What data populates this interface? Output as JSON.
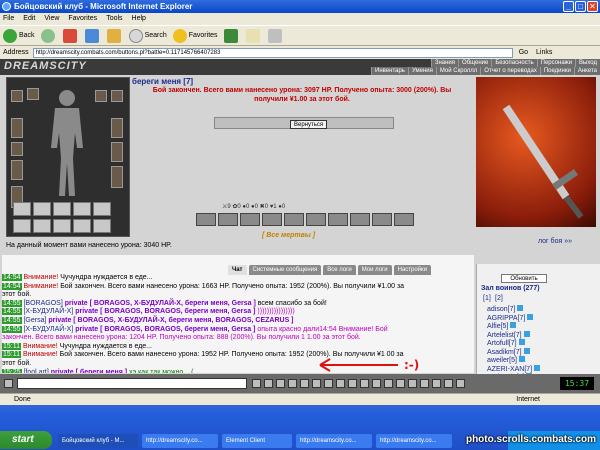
{
  "window": {
    "title": "Бойцовский клуб - Microsoft Internet Explorer",
    "menu": [
      "File",
      "Edit",
      "View",
      "Favorites",
      "Tools",
      "Help"
    ],
    "toolbar": {
      "back": "Back",
      "search": "Search",
      "favorites": "Favorites"
    },
    "address_label": "Address",
    "address_value": "http://dreamscity.combats.com/buttons.pl?battle=0.117145766407283",
    "go": "Go",
    "links": "Links"
  },
  "game": {
    "logo": "DREAMSCITY",
    "nav_top": [
      "Знания",
      "Общение",
      "Безопасность",
      "Персонажи",
      "Выход"
    ],
    "nav_bottom": [
      "Инвентарь",
      "Умения",
      "Мой Скроллл",
      "Отчет о переводах",
      "Поединки",
      "Анкета"
    ],
    "fighter_name": "береги меня [7]",
    "battle_result_line1": "Бой закончен. Всего вами нанесено урона: 3097 HP. Получено опыта: 3000 (200%). Вы",
    "battle_result_line2": "получили ¥1.00 за этот бой.",
    "return_button": "Вернуться",
    "counters": "⚔9   ✿0   ●0   ●0   ✖0   ♥1   ●0",
    "all_dead": "[ Все мертвы ]",
    "damage_text": "На данный момент вами нанесено урона: 3040 HP.",
    "battle_log_link": "лог боя »»"
  },
  "chat": {
    "tabs": [
      "Чат",
      "Системные сообщения",
      "Все логи",
      "Мои логи",
      "Настройки"
    ],
    "active_tab": "Чат",
    "lines": [
      {
        "t": "14:54",
        "parts": [
          {
            "c": "warn",
            "v": "Внимание!"
          },
          {
            "c": "",
            "v": " Чучундра нуждается в еде..."
          }
        ]
      },
      {
        "t": "14:54",
        "parts": [
          {
            "c": "warn",
            "v": "Внимание!"
          },
          {
            "c": "",
            "v": " Бой закончен. Всего вами нанесено урона: 1663 HP. Получено опыта: 1952 (200%). Вы получили ¥1.00 за"
          }
        ]
      },
      {
        "t": "",
        "parts": [
          {
            "c": "",
            "v": "этот бой."
          }
        ]
      },
      {
        "t": "14:55",
        "parts": [
          {
            "c": "nick",
            "v": "[BORAGOS]"
          },
          {
            "c": "priv",
            "v": " private [ BORAGOS, Х-БУДУЛАЙ-Х, береги меня, Gersa ]"
          },
          {
            "c": "",
            "v": " всем спасибо за бой!"
          }
        ]
      },
      {
        "t": "14:55",
        "parts": [
          {
            "c": "nick",
            "v": "[Х-БУДУЛАЙ-Х]"
          },
          {
            "c": "priv",
            "v": " private [ BORAGOS, BORAGOS, береги меня, Gersa ]"
          },
          {
            "c": "magenta",
            "v": " ))))))))))))))))"
          }
        ]
      },
      {
        "t": "",
        "parts": [
          {
            "c": "",
            "v": " "
          }
        ]
      },
      {
        "t": "14:55",
        "parts": [
          {
            "c": "nick",
            "v": "[Gersa]"
          },
          {
            "c": "priv",
            "v": " private [ BORAGOS, Х-БУДУЛАЙ-Х, береги меня, BORAGOS, CEZARUS ]"
          }
        ]
      },
      {
        "t": "14:55",
        "parts": [
          {
            "c": "nick",
            "v": "[Х-БУДУЛАЙ-Х]"
          },
          {
            "c": "priv",
            "v": " private [ BORAGOS, BORAGOS, береги меня, Gersa ]"
          },
          {
            "c": "magenta",
            "v": " опыта красно дали14:54 Внимание! Бой"
          }
        ]
      },
      {
        "t": "",
        "parts": [
          {
            "c": "magenta",
            "v": "закончен. Всего вами нанесено урона: 1204 HP. Получено опыта: 888 (200%). Вы получили 1 1.00 за этот бой."
          }
        ]
      },
      {
        "t": "15:11",
        "parts": [
          {
            "c": "warn",
            "v": "Внимание!"
          },
          {
            "c": "",
            "v": " Чучундра нуждается в еде..."
          }
        ]
      },
      {
        "t": "15:11",
        "parts": [
          {
            "c": "warn",
            "v": "Внимание!"
          },
          {
            "c": "",
            "v": " Бой закончен. Всего вами нанесено урона: 1952 HP. Получено опыта: 1952 (200%). Вы получили ¥1 00 за"
          }
        ]
      },
      {
        "t": "",
        "parts": [
          {
            "c": "",
            "v": "этот бой."
          }
        ]
      },
      {
        "t": "15:25",
        "parts": [
          {
            "c": "nick",
            "v": "[fool art]"
          },
          {
            "c": "priv",
            "v": " private [ береги меня ]"
          },
          {
            "c": "green",
            "v": " хэ как так можно... ("
          }
        ]
      },
      {
        "t": "15:26",
        "parts": [
          {
            "c": "nick",
            "v": "[fool art]"
          },
          {
            "c": "priv",
            "v": " private [ береги меня ]"
          },
          {
            "c": "green",
            "v": " вы багнутые... никто так как вы не бьёт"
          }
        ]
      },
      {
        "t": "15:34",
        "parts": [
          {
            "c": "warn",
            "v": "Внимание!"
          },
          {
            "c": "",
            "v": " Чучундра нуждается в еде..."
          }
        ]
      },
      {
        "t": "15:34",
        "parts": [
          {
            "c": "warn",
            "v": "Внимание!"
          },
          {
            "c": "",
            "v": " Бой закончен. Всего вами нанесено урона: 3097 HP. Получено опыта: 3000 (200%). Вы получили ¥1.00 за"
          }
        ]
      },
      {
        "t": "",
        "parts": [
          {
            "c": "",
            "v": "этот бой."
          }
        ]
      }
    ],
    "smiley": ":-)"
  },
  "sidebar": {
    "refresh_button": "Обновить",
    "hall_title": "Зал воинов (277)",
    "pages": [
      "[1]",
      "[2]"
    ],
    "players": [
      "adison[7]",
      "AGRIPPA[7]",
      "Alfie[5]",
      "Artelelist[7]",
      "Artofull[7]",
      "Asadikm[7]",
      "aweiler[5]",
      "AZERI-XAN[7]",
      "Badgenie[7]",
      "Bar Bastl [2]"
    ]
  },
  "clock": "15:37",
  "statusbar": {
    "status": "Done",
    "zone": "Internet"
  },
  "taskbar": {
    "start": "start",
    "tasks": [
      "Бойцовский клуб - M...",
      "http://dreamscity.co...",
      "Element Client",
      "http://dreamscity.co...",
      "http://dreamscity.co..."
    ]
  },
  "watermark": "photo.scrolls.combats.com"
}
